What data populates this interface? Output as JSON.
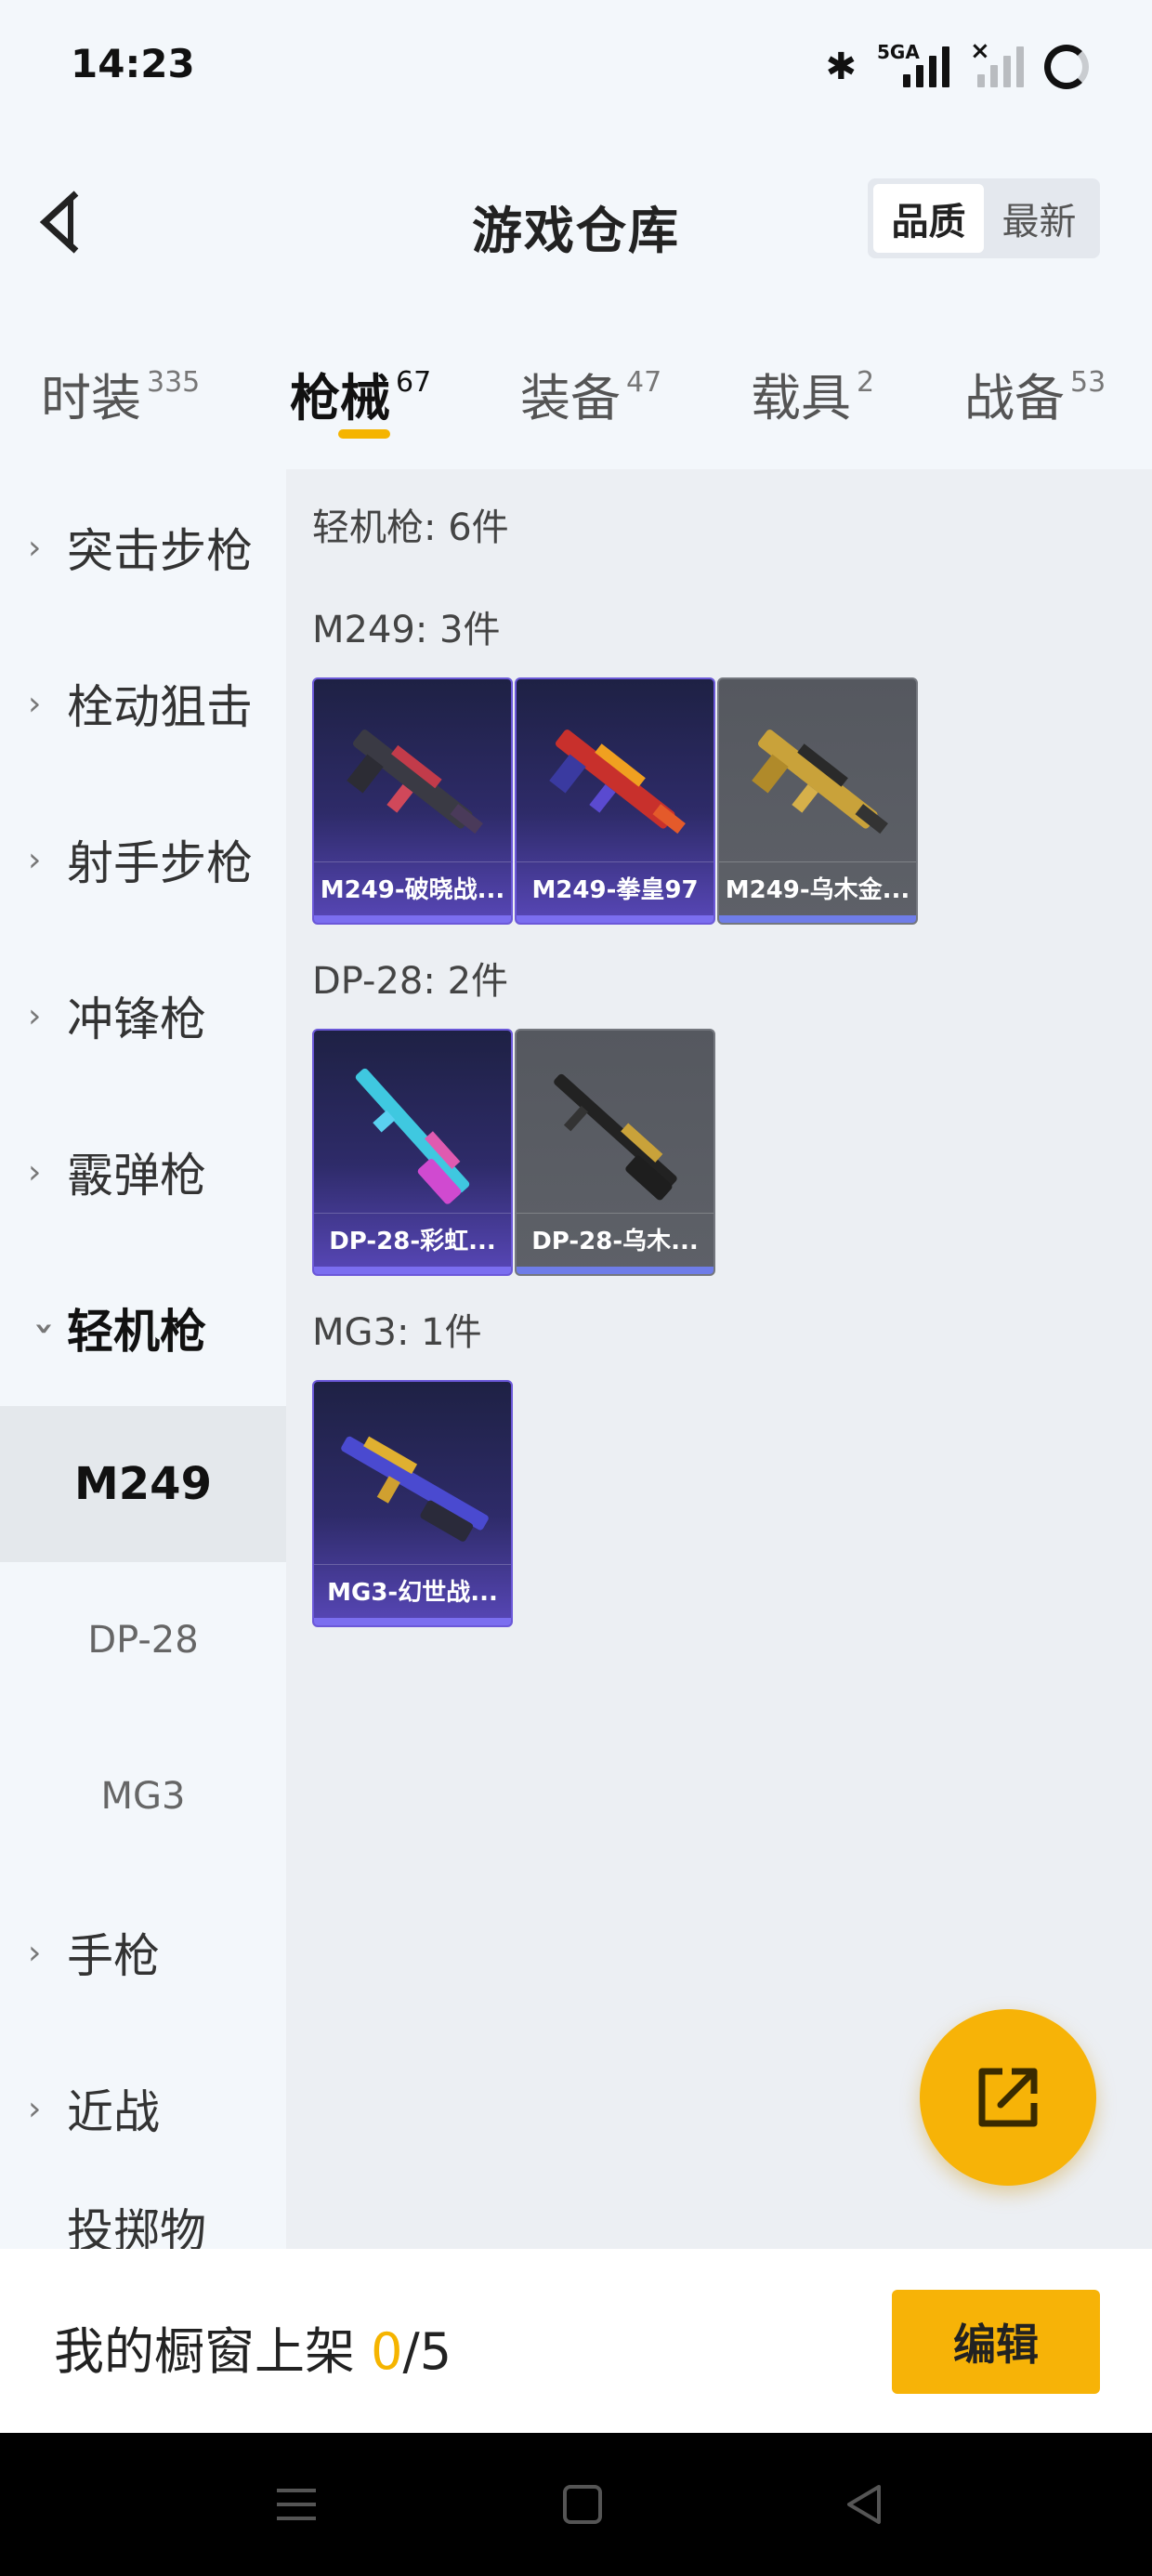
{
  "status_bar": {
    "time": "14:23",
    "network_label": "5GA"
  },
  "header": {
    "title": "游戏仓库",
    "sort_options": [
      "品质",
      "最新"
    ]
  },
  "tabs": [
    {
      "label": "时装",
      "count": "335"
    },
    {
      "label": "枪械",
      "count": "67"
    },
    {
      "label": "装备",
      "count": "47"
    },
    {
      "label": "载具",
      "count": "2"
    },
    {
      "label": "战备",
      "count": "53"
    }
  ],
  "sidebar": {
    "items": [
      "突击步枪",
      "栓动狙击",
      "射手步枪",
      "冲锋枪",
      "霰弹枪",
      "轻机枪"
    ],
    "sub_items": [
      "M249",
      "DP-28",
      "MG3"
    ],
    "items_after": [
      "手枪",
      "近战",
      "投掷物"
    ]
  },
  "content": {
    "section_title": "轻机枪: 6件",
    "groups": [
      {
        "title": "M249: 3件",
        "items": [
          "M249-破晓战...",
          "M249-拳皇97",
          "M249-乌木金..."
        ]
      },
      {
        "title": "DP-28: 2件",
        "items": [
          "DP-28-彩虹...",
          "DP-28-乌木..."
        ]
      },
      {
        "title": "MG3: 1件",
        "items": [
          "MG3-幻世战..."
        ]
      }
    ]
  },
  "showcase": {
    "prefix": "我的橱窗上架 ",
    "current": "0",
    "total": "/5",
    "edit_label": "编辑"
  },
  "colors": {
    "accent": "#f5b400",
    "purple_card": "#2e2b69",
    "grey_card": "#5e6168"
  },
  "icons": [
    "back-arrow-icon",
    "share-icon",
    "menu-icon",
    "home-icon",
    "back-icon"
  ]
}
